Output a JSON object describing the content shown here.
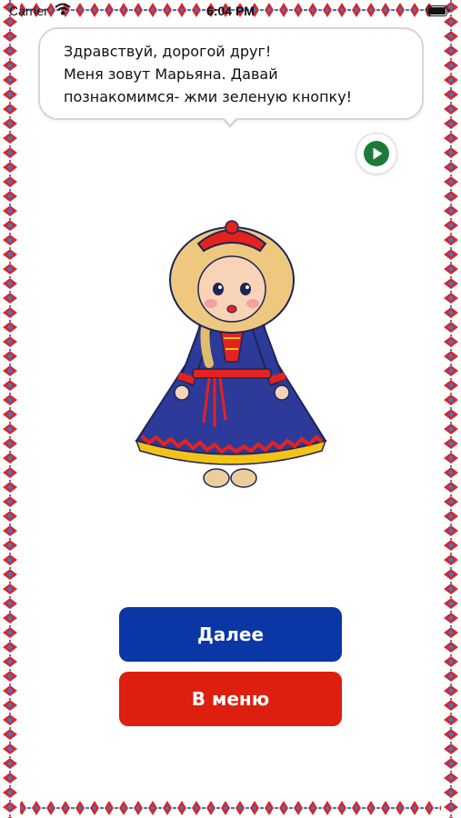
{
  "status_bar": {
    "carrier": "Carrier",
    "time": "6:04 PM"
  },
  "bubble": {
    "lines": [
      "Здравствуй, дорогой друг!",
      "Меня зовут Марьяна. Давай",
      "познакомимся- жми зеленую кнопку!"
    ]
  },
  "buttons": {
    "next_label": "Далее",
    "menu_label": "В меню"
  },
  "icons": {
    "play": "play-icon",
    "wifi": "wifi-icon",
    "battery": "battery-icon"
  },
  "colors": {
    "ornament_red": "#d8262c",
    "ornament_blue": "#2e7fd0",
    "next_button": "#0a36a6",
    "menu_button": "#dc1f0e",
    "play_green": "#1d7a3a"
  }
}
